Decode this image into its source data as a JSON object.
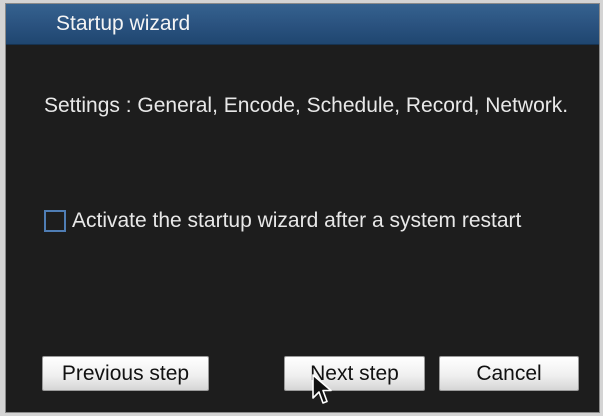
{
  "window": {
    "title": "Startup wizard"
  },
  "content": {
    "settings_text": "Settings : General, Encode, Schedule, Record, Network.",
    "checkbox_label": "Activate the startup wizard after a system restart",
    "checkbox_checked": false
  },
  "buttons": {
    "previous": "Previous step",
    "next": "Next step",
    "cancel": "Cancel"
  },
  "colors": {
    "title_bar": "#2b5380",
    "background": "#1d1d1d",
    "checkbox_border": "#4f7db4"
  },
  "icons": {
    "cursor": "mouse-pointer-icon"
  }
}
